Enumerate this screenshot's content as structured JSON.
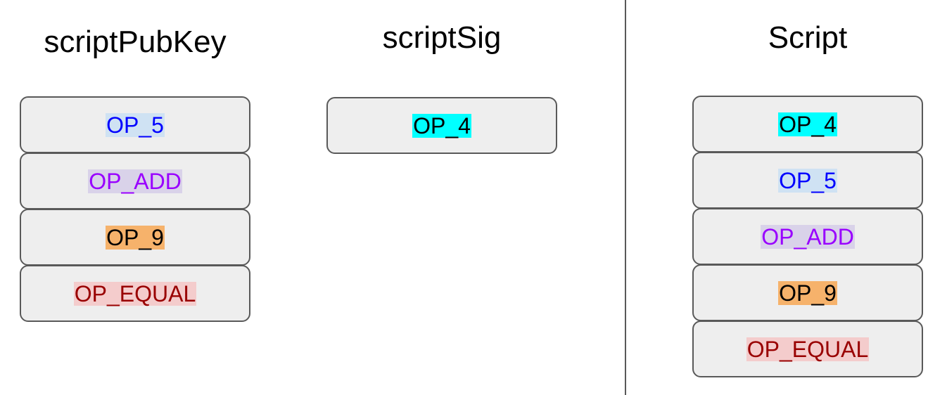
{
  "titles": {
    "pubkey": "scriptPubKey",
    "sig": "scriptSig",
    "script": "Script"
  },
  "opcodes": {
    "OP_4": {
      "text": "OP_4",
      "color": "#000000",
      "highlight": "#00ffff"
    },
    "OP_5": {
      "text": "OP_5",
      "color": "#0000ff",
      "highlight": "#cfe2f3"
    },
    "OP_ADD": {
      "text": "OP_ADD",
      "color": "#9900ff",
      "highlight": "#d9d2e9"
    },
    "OP_9": {
      "text": "OP_9",
      "color": "#000000",
      "highlight": "#f6b26b"
    },
    "OP_EQUAL": {
      "text": "OP_EQUAL",
      "color": "#990000",
      "highlight": "#f4cccc"
    }
  },
  "stacks": {
    "pubkey": [
      "OP_5",
      "OP_ADD",
      "OP_9",
      "OP_EQUAL"
    ],
    "sig": [
      "OP_4"
    ],
    "script": [
      "OP_4",
      "OP_5",
      "OP_ADD",
      "OP_9",
      "OP_EQUAL"
    ]
  },
  "colors": {
    "box_fill": "#eeeeee",
    "box_border": "#595959",
    "divider": "#595959"
  }
}
